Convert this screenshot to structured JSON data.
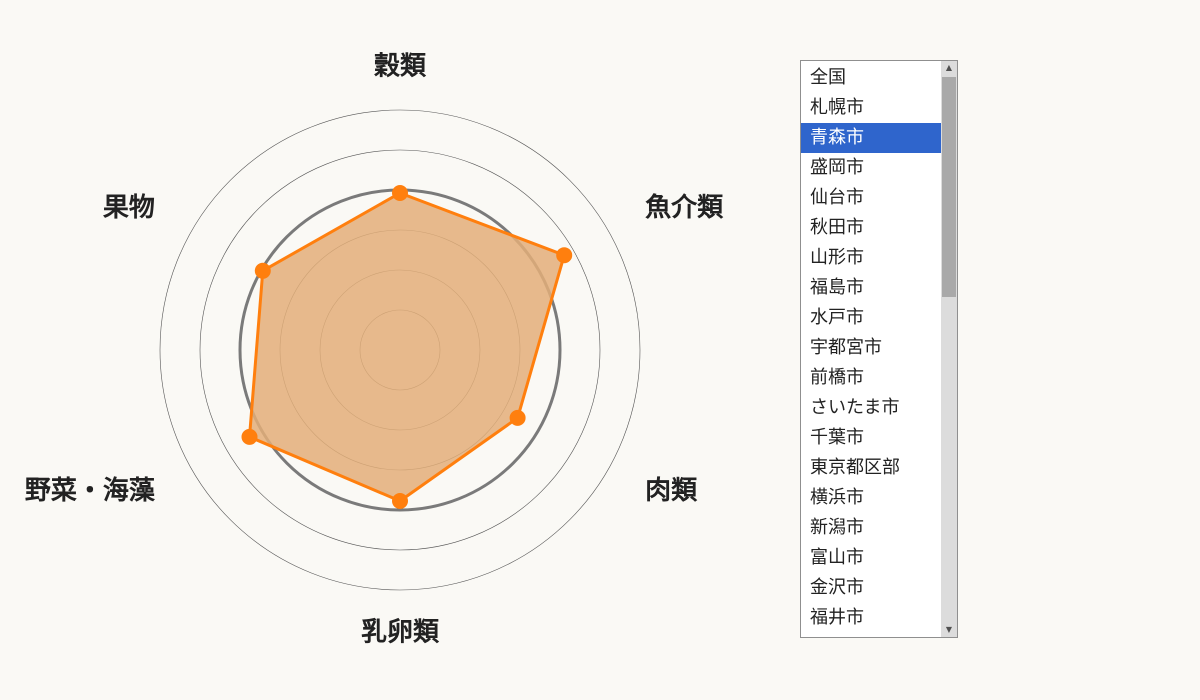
{
  "chart_data": {
    "type": "radar",
    "axes": [
      "穀類",
      "魚介類",
      "肉類",
      "乳卵類",
      "野菜・海藻",
      "果物"
    ],
    "rings": [
      20,
      40,
      60,
      80,
      100,
      120
    ],
    "highlight_ring": 80,
    "rmax": 120,
    "values": [
      78.5,
      94.8,
      67.9,
      75.5,
      86.9,
      79.2
    ],
    "series_color": "#ff7f0e",
    "fill_color": "#e3ae79"
  },
  "city_list": {
    "selected_index": 2,
    "items": [
      "全国",
      "札幌市",
      "青森市",
      "盛岡市",
      "仙台市",
      "秋田市",
      "山形市",
      "福島市",
      "水戸市",
      "宇都宮市",
      "前橋市",
      "さいたま市",
      "千葉市",
      "東京都区部",
      "横浜市",
      "新潟市",
      "富山市",
      "金沢市",
      "福井市"
    ]
  },
  "scrollbar": {
    "up_icon": "triangle-up-icon",
    "down_icon": "triangle-down-icon"
  }
}
